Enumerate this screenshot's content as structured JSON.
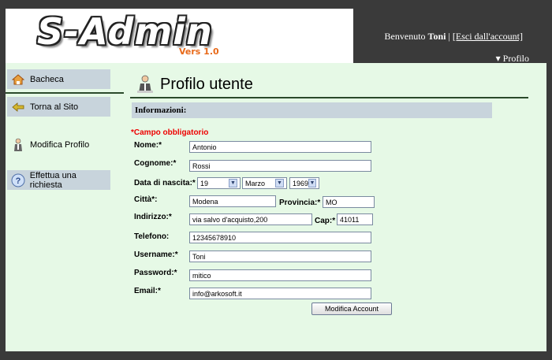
{
  "header": {
    "logo_text": "S-Admin",
    "logo_version": "Vers 1.0",
    "welcome_prefix": "Benvenuto ",
    "user_name": "Toni",
    "separator": " | ",
    "logout_label": "[Esci dall'account]",
    "profile_menu_label": "▾ Profilo"
  },
  "sidebar": {
    "items": [
      {
        "label": "Bacheca",
        "icon": "home-icon"
      },
      {
        "label": "Torna al Sito",
        "icon": "arrow-left-icon"
      },
      {
        "label": "Modifica Profilo",
        "icon": "user-icon"
      },
      {
        "label": "Effettua una richiesta",
        "icon": "help-icon"
      }
    ]
  },
  "main": {
    "title": "Profilo utente",
    "section_title": "Informazioni:",
    "required_note": "*Campo obbligatorio"
  },
  "form": {
    "nome_label": "Nome:*",
    "nome_value": "Antonio",
    "cognome_label": "Cognome:*",
    "cognome_value": "Rossi",
    "nascita_label": "Data di nascita:*",
    "giorno": "19",
    "mese": "Marzo",
    "anno": "1969",
    "citta_label": "Città*:",
    "citta_value": "Modena",
    "provincia_label": "Provincia:*",
    "provincia_value": "MO",
    "indirizzo_label": "Indirizzo:*",
    "indirizzo_value": "via salvo d'acquisto,200",
    "cap_label": "Cap:*",
    "cap_value": "41011",
    "telefono_label": "Telefono:",
    "telefono_value": "12345678910",
    "username_label": "Username:*",
    "username_value": "Toni",
    "password_label": "Password:*",
    "password_value": "mitico",
    "email_label": "Email:*",
    "email_value": "info@arkosoft.it",
    "submit_label": "Modifica Account"
  },
  "colors": {
    "content_bg": "#e6f9e6",
    "bar_bg": "#c8d4dc",
    "frame_bg": "#3a3a3a",
    "required_red": "#e00000",
    "version_orange": "#e86a1a"
  }
}
